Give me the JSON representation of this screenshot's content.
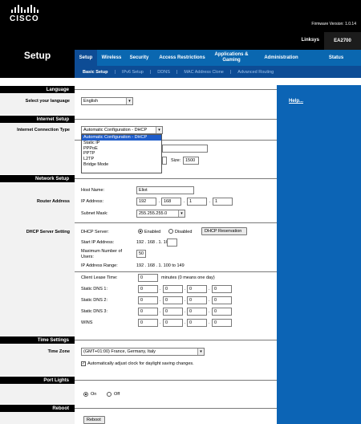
{
  "header": {
    "brand": "CISCO",
    "firmware": "Firmware Version: 1.0.14",
    "product": "Linksys",
    "model": "EA2700"
  },
  "section_title": "Setup",
  "tabs": [
    "Setup",
    "Wireless",
    "Security",
    "Access Restrictions",
    "Applications & Gaming",
    "Administration",
    "Status"
  ],
  "subtabs": [
    "Basic Setup",
    "IPv6 Setup",
    "DDNS",
    "MAC Address Clone",
    "Advanced Routing"
  ],
  "help_link": "Help...",
  "language": {
    "section": "Language",
    "label": "Select your language",
    "value": "English"
  },
  "internet": {
    "section": "Internet Setup",
    "label": "Internet Connection Type",
    "value": "Automatic Configuration - DHCP",
    "options": [
      "Automatic Configuration - DHCP",
      "Static IP",
      "PPPoE",
      "PPTP",
      "L2TP",
      "Bridge Mode"
    ],
    "size_label": "Size:",
    "size_value": "1500"
  },
  "network": {
    "section": "Network Setup",
    "router_label": "Router Address",
    "host_name_label": "Host Name:",
    "host_name": "Eliot",
    "ip_label": "IP Address:",
    "ip": [
      "192",
      "168",
      "1",
      "1"
    ],
    "subnet_label": "Subnet Mask:",
    "subnet": "255.255.255.0"
  },
  "dhcp": {
    "label": "DHCP Server Setting",
    "server_label": "DHCP Server:",
    "enabled": "Enabled",
    "disabled": "Disabled",
    "reservation_button": "DHCP Reservation",
    "start_ip_label": "Start IP  Address:",
    "start_ip": "192 . 168 . 1. 100",
    "max_users_label1": "Maximum Number of",
    "max_users_label2": "Users:",
    "max_users": "50",
    "range_label": "IP Address Range:",
    "range": "192 . 168 . 1. 100 to 149",
    "lease_label": "Client Lease Time:",
    "lease_value": "0",
    "lease_suffix": "minutes (0 means one day)",
    "dns1_label": "Static DNS 1:",
    "dns2_label": "Static DNS 2:",
    "dns3_label": "Static DNS 3:",
    "wins_label": "WINS",
    "zero": "0"
  },
  "time": {
    "section": "Time Settings",
    "label": "Time Zone",
    "value": "(GMT+01:00) France, Germany, Italy",
    "dst_label": "Automatically adjust clock for daylight saving changes."
  },
  "port_lights": {
    "section": "Port Lights",
    "on": "On",
    "off": "Off"
  },
  "reboot": {
    "section": "Reboot",
    "button": "Reboot"
  }
}
